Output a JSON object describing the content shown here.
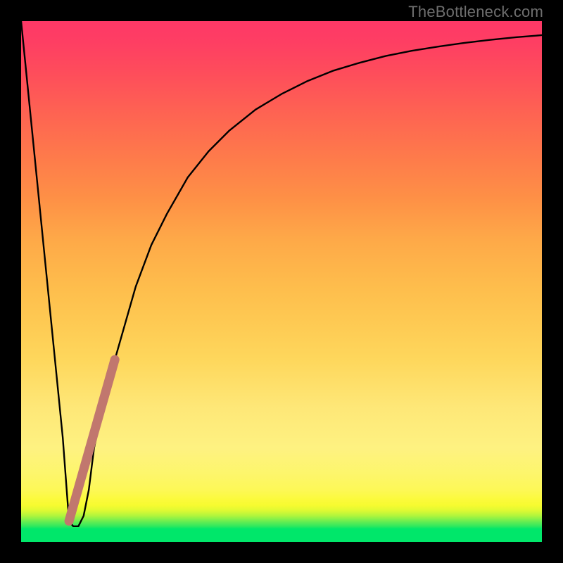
{
  "watermark": "TheBottleneck.com",
  "colors": {
    "frame": "#000000",
    "curve": "#000000",
    "marker": "#c1776e"
  },
  "chart_data": {
    "type": "line",
    "title": "",
    "xlabel": "",
    "ylabel": "",
    "xlim": [
      0,
      100
    ],
    "ylim": [
      0,
      100
    ],
    "grid": false,
    "legend": false,
    "series": [
      {
        "name": "bottleneck-curve",
        "x": [
          0,
          2,
          4,
          6,
          8,
          9.2,
          10,
          11,
          12,
          13,
          14,
          16,
          18,
          20,
          22,
          25,
          28,
          32,
          36,
          40,
          45,
          50,
          55,
          60,
          65,
          70,
          75,
          80,
          85,
          90,
          95,
          100
        ],
        "y": [
          100,
          80,
          60,
          40,
          20,
          4,
          3,
          3,
          5,
          10,
          18,
          27,
          35,
          42,
          49,
          57,
          63,
          70,
          75,
          79,
          83,
          86,
          88.5,
          90.5,
          92,
          93.3,
          94.3,
          95.1,
          95.8,
          96.4,
          96.9,
          97.3
        ]
      }
    ],
    "marker_segment": {
      "name": "highlight",
      "x": [
        9.2,
        18.0
      ],
      "y": [
        4,
        35
      ]
    }
  }
}
